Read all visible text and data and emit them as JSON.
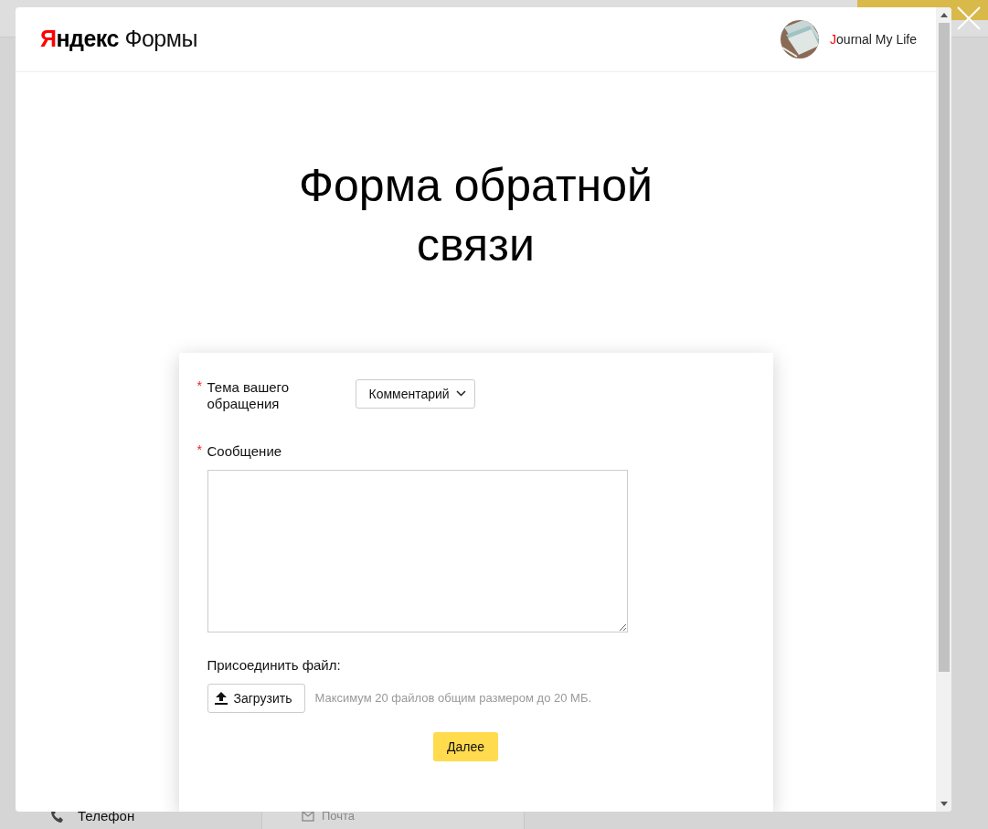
{
  "background": {
    "contacts": [
      {
        "kind": "phone",
        "label": "Телефон"
      },
      {
        "kind": "mail",
        "label": "Почта"
      }
    ]
  },
  "header": {
    "logo_brand": "Яндекс",
    "logo_product": "Формы",
    "user_name": "Journal My Life"
  },
  "form": {
    "title": "Форма обратной связи",
    "fields": [
      {
        "kind": "select",
        "label": "Тема вашего обращения",
        "required_mark": "*",
        "value": "Комментарий"
      },
      {
        "kind": "textarea",
        "label": "Сообщение",
        "required_mark": "*"
      },
      {
        "kind": "file",
        "label": "Присоединить файл:",
        "button": "Загрузить",
        "hint": "Максимум 20 файлов общим размером до 20 МБ."
      }
    ],
    "submit": "Далее"
  }
}
